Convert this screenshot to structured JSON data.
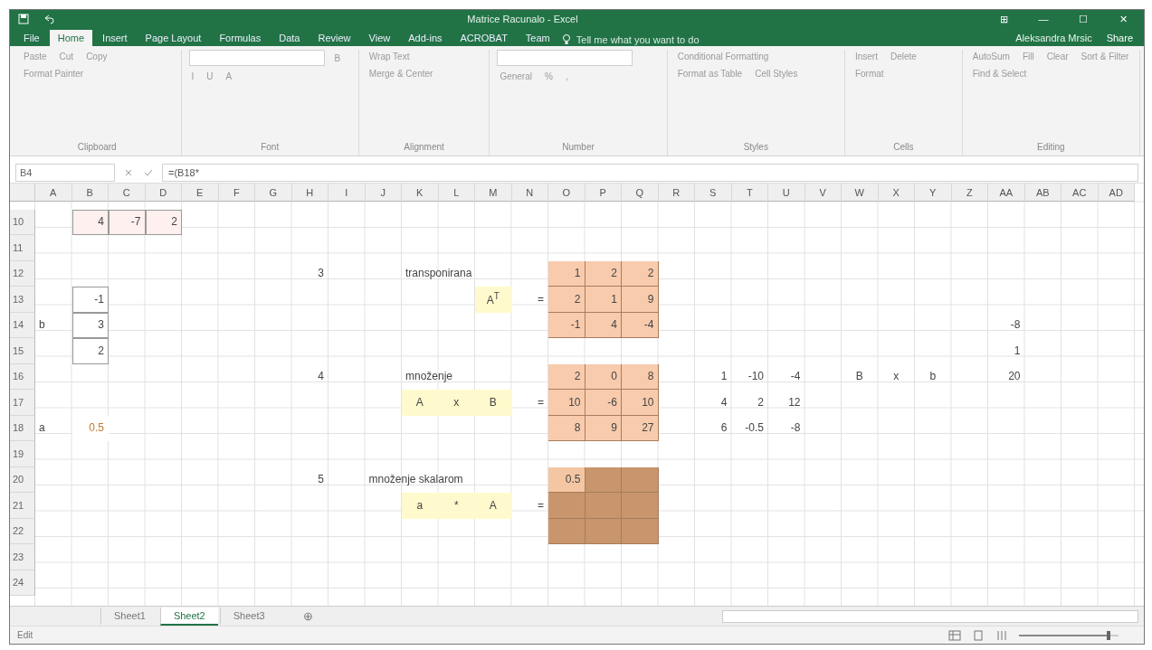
{
  "window": {
    "title": "Matrice Racunalo - Excel",
    "controls": [
      "⊞",
      "—",
      "☐",
      "✕"
    ]
  },
  "menu_tabs": [
    {
      "label": "File",
      "selected": false
    },
    {
      "label": "Home",
      "selected": true
    },
    {
      "label": "Insert",
      "selected": false
    },
    {
      "label": "Page Layout",
      "selected": false
    },
    {
      "label": "Formulas",
      "selected": false
    },
    {
      "label": "Data",
      "selected": false
    },
    {
      "label": "Review",
      "selected": false
    },
    {
      "label": "View",
      "selected": false
    },
    {
      "label": "Add-ins",
      "selected": false
    },
    {
      "label": "ACROBAT",
      "selected": false
    },
    {
      "label": "Team",
      "selected": false
    }
  ],
  "tell_me": {
    "placeholder": "Tell me what you want to do"
  },
  "user": "Aleksandra Mrsic",
  "share": "Share",
  "ribbon_groups": [
    {
      "kind": "clipboard",
      "label": "Clipboard",
      "items": [
        "Paste",
        "Cut",
        "Copy",
        "Format Painter"
      ]
    },
    {
      "kind": "font",
      "label": "Font",
      "items": [
        "B",
        "I",
        "U",
        "A"
      ]
    },
    {
      "kind": "alignment",
      "label": "Alignment",
      "items": [
        "Wrap Text",
        "Merge & Center"
      ]
    },
    {
      "kind": "number",
      "label": "Number",
      "items": [
        "General",
        "%",
        ","
      ]
    },
    {
      "kind": "styles",
      "label": "Styles",
      "items": [
        "Conditional Formatting",
        "Format as Table",
        "Cell Styles"
      ]
    },
    {
      "kind": "cells",
      "label": "Cells",
      "items": [
        "Insert",
        "Delete",
        "Format"
      ]
    },
    {
      "kind": "editing",
      "label": "Editing",
      "items": [
        "AutoSum",
        "Fill",
        "Clear",
        "Sort & Filter",
        "Find & Select"
      ]
    }
  ],
  "formula_bar": {
    "name_box": "B4",
    "formula": "=(B18*"
  },
  "columns": [
    "A",
    "B",
    "C",
    "D",
    "E",
    "F",
    "G",
    "H",
    "I",
    "J",
    "K",
    "L",
    "M",
    "N",
    "O",
    "P",
    "Q",
    "R",
    "S",
    "T",
    "U",
    "V",
    "W",
    "X",
    "Y",
    "Z",
    "AA",
    "AB",
    "AC",
    "AD"
  ],
  "rows": [
    {
      "label": "10",
      "cells": [
        {},
        {
          "text": "4",
          "kind": "pinkbox"
        },
        {
          "text": "-7",
          "kind": "pinkbox"
        },
        {
          "text": "2",
          "kind": "pinkbox"
        },
        {},
        {},
        {},
        {},
        {},
        {},
        {},
        {},
        {},
        {},
        {},
        {},
        {},
        {},
        {},
        {},
        {},
        {},
        {},
        {},
        {},
        {},
        {},
        {},
        {},
        {}
      ]
    },
    {
      "label": "11"
    },
    {
      "label": "12",
      "cells": [
        {},
        {},
        {},
        {},
        {},
        {},
        {},
        {
          "text": "3"
        },
        {},
        {},
        {
          "text": "transponirana",
          "kind": "label"
        },
        {},
        {},
        {},
        {
          "text": "1",
          "kind": "orange"
        },
        {
          "text": "2",
          "kind": "orange"
        },
        {
          "text": "2",
          "kind": "orange"
        },
        {},
        {},
        {},
        {},
        {},
        {},
        {},
        {},
        {},
        {},
        {},
        {},
        {}
      ]
    },
    {
      "label": "13",
      "cells": [
        {},
        {
          "text": "-1",
          "kind": "box"
        },
        {},
        {},
        {},
        {},
        {},
        {},
        {},
        {},
        {},
        {},
        {
          "text": "A$^{T}$",
          "kind": "yellow"
        },
        {
          "text": "="
        },
        {
          "text": "2",
          "kind": "orange"
        },
        {
          "text": "1",
          "kind": "orange"
        },
        {
          "text": "9",
          "kind": "orange"
        },
        {},
        {},
        {},
        {},
        {},
        {},
        {},
        {},
        {},
        {},
        {},
        {},
        {}
      ]
    },
    {
      "label": "14",
      "cells": [
        {
          "text": "b",
          "kind": "label"
        },
        {
          "text": "3",
          "kind": "box"
        },
        {},
        {},
        {},
        {},
        {},
        {},
        {},
        {},
        {},
        {},
        {},
        {},
        {
          "text": "-1",
          "kind": "orange"
        },
        {
          "text": "4",
          "kind": "orange"
        },
        {
          "text": "-4",
          "kind": "orange"
        },
        {},
        {},
        {},
        {},
        {},
        {},
        {},
        {},
        {},
        {
          "text": "-8"
        },
        {},
        {},
        {}
      ]
    },
    {
      "label": "15",
      "cells": [
        {},
        {
          "text": "2",
          "kind": "box"
        },
        {},
        {},
        {},
        {},
        {},
        {},
        {},
        {},
        {},
        {},
        {},
        {},
        {},
        {},
        {},
        {},
        {},
        {},
        {},
        {},
        {},
        {},
        {},
        {},
        {
          "text": "1"
        },
        {},
        {},
        {}
      ]
    },
    {
      "label": "16",
      "cells": [
        {},
        {},
        {},
        {},
        {},
        {},
        {},
        {
          "text": "4"
        },
        {},
        {},
        {
          "text": "množenje",
          "kind": "label"
        },
        {},
        {},
        {},
        {
          "text": "2",
          "kind": "orange"
        },
        {
          "text": "0",
          "kind": "orange"
        },
        {
          "text": "8",
          "kind": "orange"
        },
        {},
        {
          "text": "1"
        },
        {
          "text": "-10"
        },
        {
          "text": "-4"
        },
        {},
        {
          "text": "B",
          "kind": "center"
        },
        {
          "text": "x",
          "kind": "center"
        },
        {
          "text": "b",
          "kind": "center"
        },
        {},
        {
          "text": "20"
        },
        {},
        {},
        {}
      ]
    },
    {
      "label": "17",
      "cells": [
        {},
        {},
        {},
        {},
        {},
        {},
        {},
        {},
        {},
        {},
        {
          "text": "A",
          "kind": "yellow"
        },
        {
          "text": "x",
          "kind": "yellow"
        },
        {
          "text": "B",
          "kind": "yellow"
        },
        {
          "text": "="
        },
        {
          "text": "10",
          "kind": "orange"
        },
        {
          "text": "-6",
          "kind": "orange"
        },
        {
          "text": "10",
          "kind": "orange"
        },
        {},
        {
          "text": "4"
        },
        {
          "text": "2"
        },
        {
          "text": "12"
        },
        {},
        {},
        {},
        {},
        {},
        {},
        {},
        {},
        {}
      ]
    },
    {
      "label": "18",
      "cells": [
        {
          "text": "a",
          "kind": "label"
        },
        {
          "text": "0.5",
          "kind": "input"
        },
        {},
        {},
        {},
        {},
        {},
        {},
        {},
        {},
        {},
        {},
        {},
        {},
        {
          "text": "8",
          "kind": "orange"
        },
        {
          "text": "9",
          "kind": "orange"
        },
        {
          "text": "27",
          "kind": "orange"
        },
        {},
        {
          "text": "6"
        },
        {
          "text": "-0.5"
        },
        {
          "text": "-8"
        },
        {},
        {},
        {},
        {},
        {},
        {},
        {},
        {},
        {}
      ]
    },
    {
      "label": "19"
    },
    {
      "label": "20",
      "cells": [
        {},
        {},
        {},
        {},
        {},
        {},
        {},
        {
          "text": "5"
        },
        {},
        {
          "text": "množenje skalarom",
          "kind": "label"
        },
        {},
        {},
        {},
        {},
        {
          "text": "0.5",
          "kind": "active"
        },
        {
          "kind": "brown"
        },
        {
          "kind": "brown"
        },
        {},
        {},
        {},
        {},
        {},
        {},
        {},
        {},
        {},
        {},
        {},
        {},
        {}
      ]
    },
    {
      "label": "21",
      "cells": [
        {},
        {},
        {},
        {},
        {},
        {},
        {},
        {},
        {},
        {},
        {
          "text": "a",
          "kind": "yellow"
        },
        {
          "text": "*",
          "kind": "yellow"
        },
        {
          "text": "A",
          "kind": "yellow"
        },
        {
          "text": "="
        },
        {
          "kind": "brown"
        },
        {
          "kind": "brown"
        },
        {
          "kind": "brown"
        },
        {},
        {},
        {},
        {},
        {},
        {},
        {},
        {},
        {},
        {},
        {},
        {},
        {}
      ]
    },
    {
      "label": "22",
      "cells": [
        {},
        {},
        {},
        {},
        {},
        {},
        {},
        {},
        {},
        {},
        {},
        {},
        {},
        {},
        {
          "kind": "brown"
        },
        {
          "kind": "brown"
        },
        {
          "kind": "brown"
        },
        {},
        {},
        {},
        {},
        {},
        {},
        {},
        {},
        {},
        {},
        {},
        {},
        {}
      ]
    },
    {
      "label": "23"
    },
    {
      "label": "24"
    }
  ],
  "sheet_tabs": [
    {
      "label": "Sheet1",
      "selected": false
    },
    {
      "label": "Sheet2",
      "selected": true
    },
    {
      "label": "Sheet3",
      "selected": false
    }
  ],
  "add_sheet": "⊕",
  "status_bar": {
    "mode": "Edit",
    "zoom": {
      "level": 0.9
    }
  }
}
